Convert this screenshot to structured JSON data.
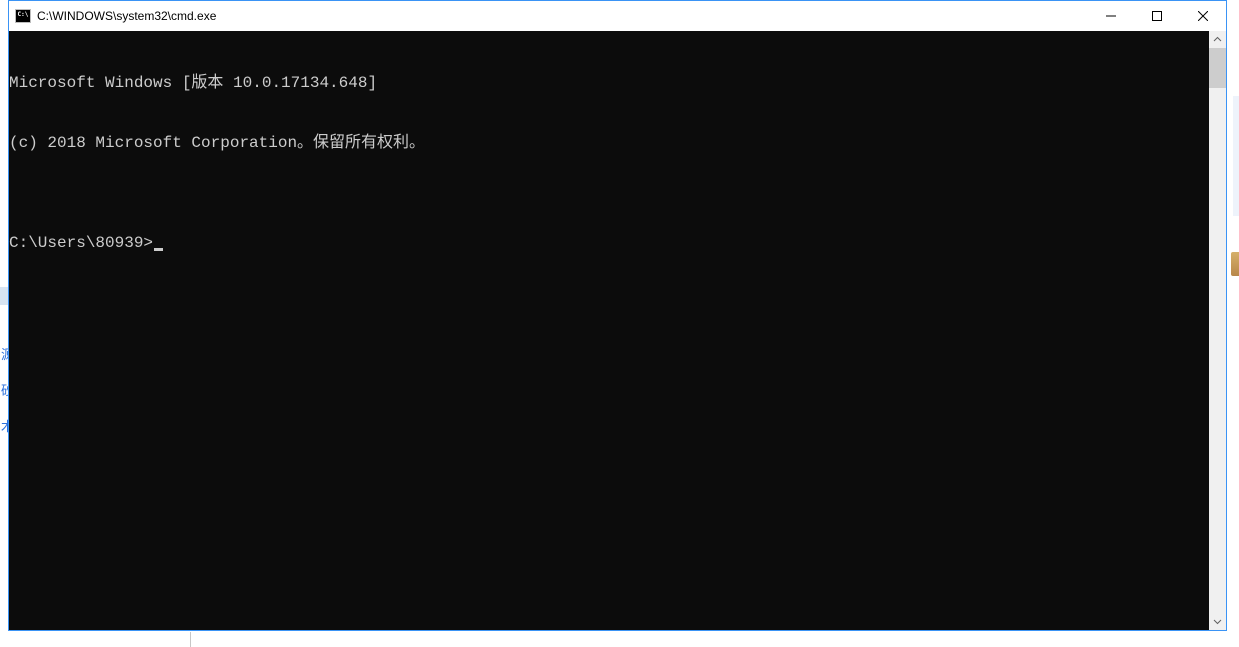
{
  "window": {
    "title": "C:\\WINDOWS\\system32\\cmd.exe"
  },
  "terminal": {
    "line1": "Microsoft Windows [版本 10.0.17134.648]",
    "line2": "(c) 2018 Microsoft Corporation。保留所有权利。",
    "blank": "",
    "prompt": "C:\\Users\\80939>"
  },
  "bg": {
    "hint_a": "源",
    "hint_b": "砂",
    "hint_c": "木"
  }
}
